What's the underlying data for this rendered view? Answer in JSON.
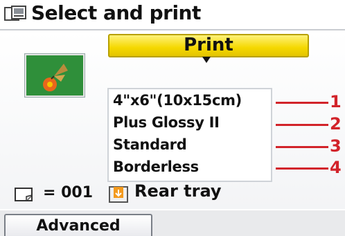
{
  "header": {
    "title": "Select and print",
    "icon": "print-menu-icon"
  },
  "thumbnail": {
    "icon": "photo-thumbnail-butterfly"
  },
  "print_button": {
    "label": "Print"
  },
  "settings": {
    "items": [
      {
        "label": "4\"x6\"(10x15cm)",
        "callout": "1"
      },
      {
        "label": "Plus Glossy II",
        "callout": "2"
      },
      {
        "label": "Standard",
        "callout": "3"
      },
      {
        "label": "Borderless",
        "callout": "4"
      }
    ]
  },
  "status": {
    "copies": "= 001",
    "copies_icon": "copies-icon",
    "paper_source": "Rear tray",
    "paper_source_icon": "rear-tray-icon"
  },
  "footer": {
    "advanced_label": "Advanced"
  },
  "colors": {
    "print_button": "#f5d800",
    "callout": "#d2232a",
    "thumbnail_bg": "#2f8f3a"
  }
}
